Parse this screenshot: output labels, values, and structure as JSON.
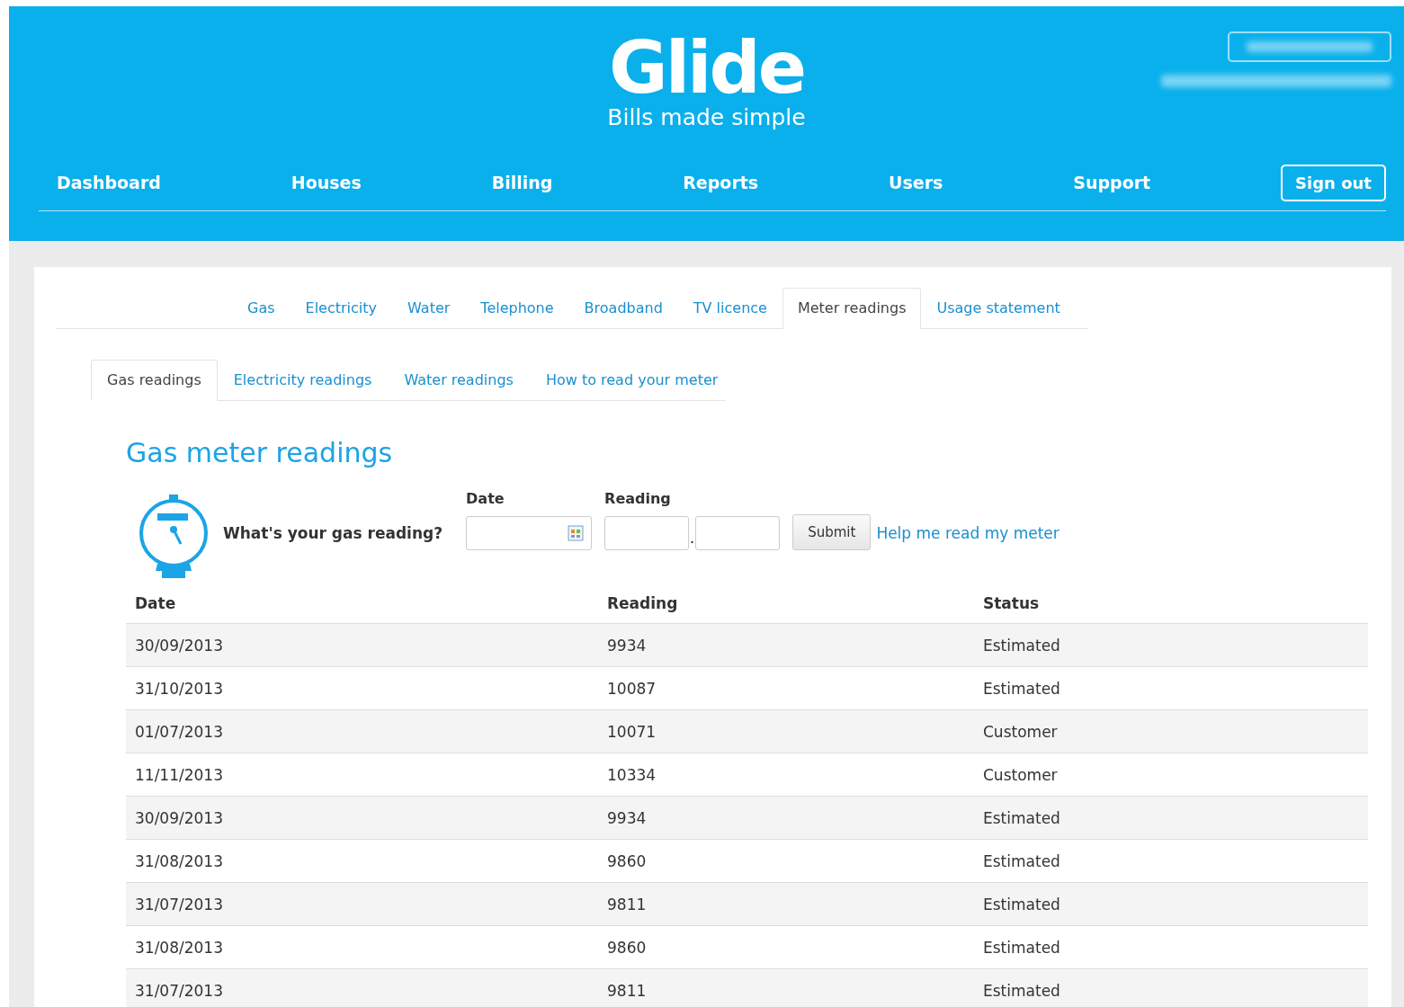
{
  "header": {
    "logo": "Glide",
    "tagline": "Bills made simple"
  },
  "nav": {
    "items": [
      {
        "label": "Dashboard"
      },
      {
        "label": "Houses"
      },
      {
        "label": "Billing"
      },
      {
        "label": "Reports"
      },
      {
        "label": "Users"
      },
      {
        "label": "Support"
      }
    ],
    "sign_out": "Sign out"
  },
  "tabs": [
    {
      "label": "Gas",
      "selected": false
    },
    {
      "label": "Electricity",
      "selected": false
    },
    {
      "label": "Water",
      "selected": false
    },
    {
      "label": "Telephone",
      "selected": false
    },
    {
      "label": "Broadband",
      "selected": false
    },
    {
      "label": "TV licence",
      "selected": false
    },
    {
      "label": "Meter readings",
      "selected": true
    },
    {
      "label": "Usage statement",
      "selected": false
    }
  ],
  "subtabs": [
    {
      "label": "Gas readings",
      "selected": true
    },
    {
      "label": "Electricity readings",
      "selected": false
    },
    {
      "label": "Water readings",
      "selected": false
    },
    {
      "label": "How to read your meter",
      "selected": false
    }
  ],
  "heading": "Gas meter readings",
  "form": {
    "question": "What's your gas reading?",
    "date_label": "Date",
    "reading_label": "Reading",
    "separator": ".",
    "submit": "Submit",
    "help_link": "Help me read my meter"
  },
  "table": {
    "columns": [
      "Date",
      "Reading",
      "Status"
    ],
    "rows": [
      [
        "30/09/2013",
        "9934",
        "Estimated"
      ],
      [
        "31/10/2013",
        "10087",
        "Estimated"
      ],
      [
        "01/07/2013",
        "10071",
        "Customer"
      ],
      [
        "11/11/2013",
        "10334",
        "Customer"
      ],
      [
        "30/09/2013",
        "9934",
        "Estimated"
      ],
      [
        "31/08/2013",
        "9860",
        "Estimated"
      ],
      [
        "31/07/2013",
        "9811",
        "Estimated"
      ],
      [
        "31/08/2013",
        "9860",
        "Estimated"
      ],
      [
        "31/07/2013",
        "9811",
        "Estimated"
      ]
    ]
  }
}
